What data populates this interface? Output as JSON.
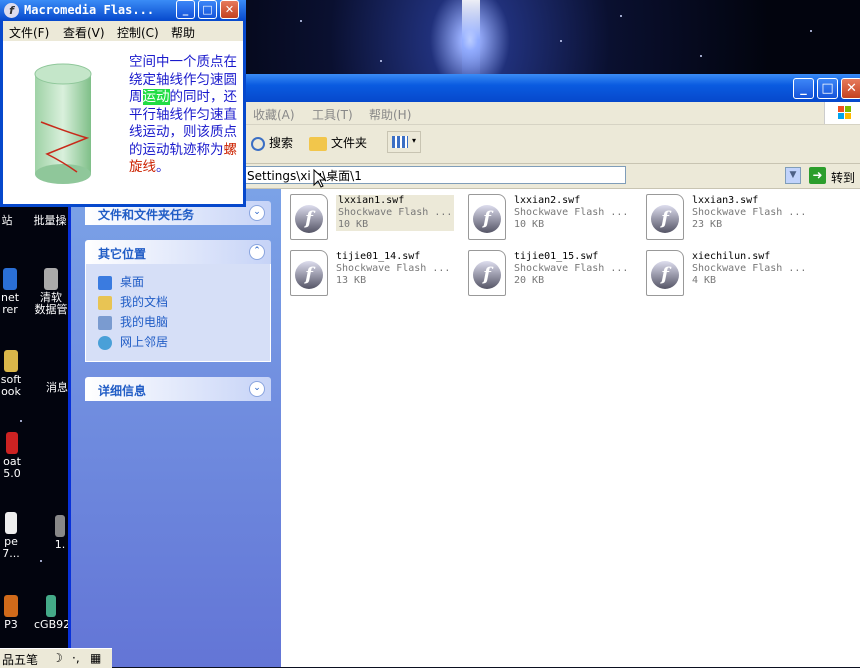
{
  "explorer": {
    "menu": [
      "收藏(A)",
      "工具(T)",
      "帮助(H)"
    ],
    "toolbar": {
      "search": "搜索",
      "folders": "文件夹"
    },
    "address": {
      "path": "Settings\\xi  g\\桌面\\1",
      "go": "转到"
    },
    "tasks": {
      "file_tasks": "文件和文件夹任务",
      "other_places": "其它位置",
      "places": [
        "桌面",
        "我的文档",
        "我的电脑",
        "网上邻居"
      ],
      "details": "详细信息"
    },
    "files": [
      {
        "name": "lxxian1.swf",
        "type": "Shockwave Flash ...",
        "size": "10 KB"
      },
      {
        "name": "lxxian2.swf",
        "type": "Shockwave Flash ...",
        "size": "10 KB"
      },
      {
        "name": "lxxian3.swf",
        "type": "Shockwave Flash ...",
        "size": "23 KB"
      },
      {
        "name": "tijie01_14.swf",
        "type": "Shockwave Flash ...",
        "size": "13 KB"
      },
      {
        "name": "tijie01_15.swf",
        "type": "Shockwave Flash ...",
        "size": "20 KB"
      },
      {
        "name": "xiechilun.swf",
        "type": "Shockwave Flash ...",
        "size": "4 KB"
      }
    ]
  },
  "flash": {
    "title": "Macromedia Flas...",
    "menu": [
      "文件(F)",
      "查看(V)",
      "控制(C)",
      "帮助"
    ],
    "text_pre": "空间中一个质点在绕定轴线作匀速圆周",
    "text_hl": "运动",
    "text_mid": "的同时，还平行轴线作匀速直线运动，则该质点的运动轨迹称为",
    "text_red": "螺旋线",
    "text_end": "。"
  },
  "desktop_icons": [
    "站",
    "批量操",
    "net\nrer",
    "清软\n数据管",
    "soft\nook",
    "消息",
    "oat\n5.0",
    "pe\n7...",
    "1.",
    "P3",
    "cGB92"
  ],
  "taskbar": {
    "ime": "品五笔"
  }
}
